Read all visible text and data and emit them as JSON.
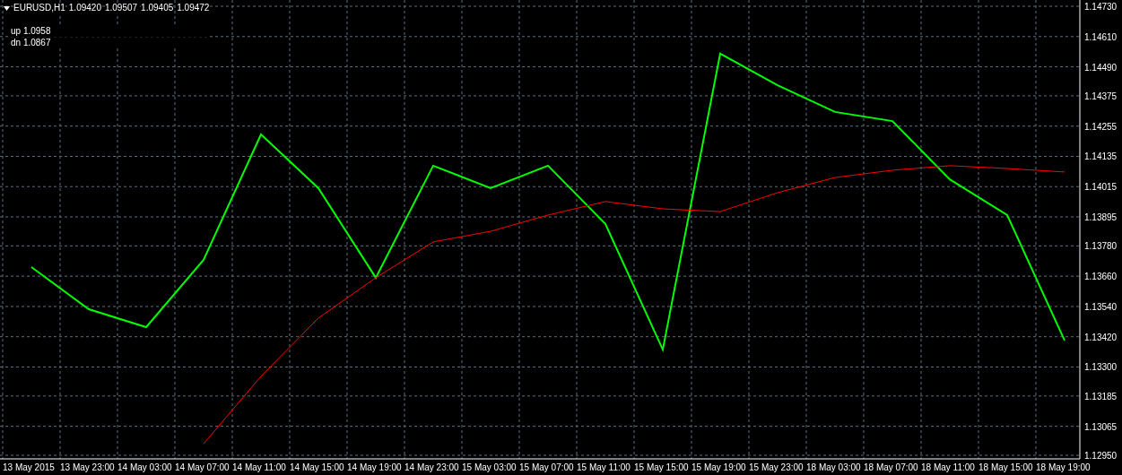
{
  "header": {
    "symbol": "EURUSD,H1",
    "quotes": [
      "1.09420",
      "1.09507",
      "1.09405",
      "1.09472"
    ]
  },
  "indicator_lines": [
    "up 1.0958",
    "dn 1.0867"
  ],
  "chart_data": {
    "type": "line",
    "x": [
      "13 May 2015",
      "13 May 23:00",
      "14 May 03:00",
      "14 May 07:00",
      "14 May 11:00",
      "14 May 15:00",
      "14 May 19:00",
      "14 May 23:00",
      "15 May 03:00",
      "15 May 07:00",
      "15 May 11:00",
      "15 May 15:00",
      "15 May 19:00",
      "15 May 23:00",
      "18 May 03:00",
      "18 May 07:00",
      "18 May 11:00",
      "18 May 15:00",
      "18 May 19:00"
    ],
    "yticks": [
      {
        "value": 1.1473,
        "label": "1.14730"
      },
      {
        "value": 1.1461,
        "label": "1.14610"
      },
      {
        "value": 1.1449,
        "label": "1.14490"
      },
      {
        "value": 1.14375,
        "label": "1.14375"
      },
      {
        "value": 1.14255,
        "label": "1.14255"
      },
      {
        "value": 1.14135,
        "label": "1.14135"
      },
      {
        "value": 1.14015,
        "label": "1.14015"
      },
      {
        "value": 1.13895,
        "label": "1.13895"
      },
      {
        "value": 1.1378,
        "label": "1.13780"
      },
      {
        "value": 1.1366,
        "label": "1.13660"
      },
      {
        "value": 1.1354,
        "label": "1.13540"
      },
      {
        "value": 1.1342,
        "label": "1.13420"
      },
      {
        "value": 1.133,
        "label": "1.13300"
      },
      {
        "value": 1.13185,
        "label": "1.13185"
      },
      {
        "value": 1.13065,
        "label": "1.13065"
      },
      {
        "value": 1.1295,
        "label": "1.12950"
      }
    ],
    "ylim": [
      1.1295,
      1.1473
    ],
    "grid": true,
    "series": [
      {
        "color": "#00ff00",
        "values": [
          1.13696,
          1.13529,
          1.13458,
          1.13725,
          1.14222,
          1.14009,
          1.13654,
          1.14098,
          1.14009,
          1.14098,
          1.13867,
          1.13369,
          1.14542,
          1.14417,
          1.14311,
          1.14275,
          1.14044,
          1.13902,
          1.13405
        ]
      },
      {
        "color": "#ff0000",
        "values": [
          null,
          null,
          null,
          1.12996,
          1.13263,
          1.13494,
          1.13654,
          1.13796,
          1.13838,
          1.13902,
          1.13956,
          1.13927,
          1.13916,
          1.13991,
          1.14051,
          1.1408,
          1.14098,
          1.14087,
          1.14073
        ]
      }
    ]
  }
}
